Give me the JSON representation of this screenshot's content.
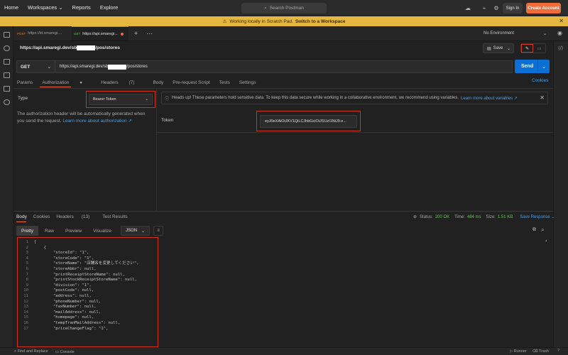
{
  "nav": {
    "home": "Home",
    "workspaces": "Workspaces",
    "reports": "Reports",
    "explore": "Explore",
    "search_placeholder": "Search Postman",
    "sign_in": "Sign In",
    "create_account": "Create Account"
  },
  "banner": {
    "text": "Working locally in Scratch Pad.",
    "link": "Switch to a Workspace"
  },
  "tabs": [
    {
      "method": "POST",
      "label": "https://id.smaregi...."
    },
    {
      "method": "GET",
      "label": "https://api.smaregi..."
    }
  ],
  "environment": "No Environment",
  "request": {
    "title_prefix": "https://api.smaregi.dev/sb",
    "title_suffix": "/pos/stores",
    "save_label": "Save",
    "method": "GET",
    "url_prefix": "https://api.smaregi.dev/sb",
    "url_suffix": "/pos/stores",
    "send_label": "Send",
    "tabs": {
      "params": "Params",
      "authorization": "Authorization",
      "headers": "Headers",
      "headers_count": "(7)",
      "body": "Body",
      "pre_request": "Pre-request Script",
      "tests": "Tests",
      "settings": "Settings"
    },
    "cookies": "Cookies"
  },
  "auth": {
    "type_label": "Type",
    "type_value": "Bearer Token",
    "help_text": "The authorization header will be automatically generated when you send the request.",
    "help_link": "Learn more about authorization ↗",
    "heads_up": "Heads up! These parameters hold sensitive data. To keep this data secure while working in a collaborative environment, we recommend using variables.",
    "heads_up_link": "Learn more about variables ↗",
    "token_label": "Token",
    "token_value": "eyJ0eXAiOiJKV1QiLCJhbGciOiJSUzI1NiJ9.e..."
  },
  "response": {
    "tabs": {
      "body": "Body",
      "cookies": "Cookies",
      "headers": "Headers",
      "headers_count": "(13)",
      "test_results": "Test Results"
    },
    "status_label": "Status:",
    "status_value": "200 OK",
    "time_label": "Time:",
    "time_value": "484 ms",
    "size_label": "Size:",
    "size_value": "1.51 KB",
    "save_response": "Save Response",
    "view_tabs": [
      "Pretty",
      "Raw",
      "Preview",
      "Visualize"
    ],
    "format": "JSON",
    "code_lines": [
      {
        "n": "1",
        "text": "["
      },
      {
        "n": "2",
        "text": "    {"
      },
      {
        "n": "3",
        "text": "        \"storeId\": \"1\","
      },
      {
        "n": "4",
        "text": "        \"storeCode\": \"1\","
      },
      {
        "n": "5",
        "text": "        \"storeName\": \"店舗名を変更してください\","
      },
      {
        "n": "6",
        "text": "        \"storeAbbr\": null,"
      },
      {
        "n": "7",
        "text": "        \"printReceiptStoreName\": null,"
      },
      {
        "n": "8",
        "text": "        \"printStockReceiptStoreName\": null,"
      },
      {
        "n": "9",
        "text": "        \"division\": \"1\","
      },
      {
        "n": "10",
        "text": "        \"postCode\": null,"
      },
      {
        "n": "11",
        "text": "        \"address\": null,"
      },
      {
        "n": "12",
        "text": "        \"phoneNumber\": null,"
      },
      {
        "n": "13",
        "text": "        \"faxNumber\": null,"
      },
      {
        "n": "14",
        "text": "        \"mailAddress\": null,"
      },
      {
        "n": "15",
        "text": "        \"homepage\": null,"
      },
      {
        "n": "16",
        "text": "        \"tempTranMailAddress\": null,"
      },
      {
        "n": "17",
        "text": "        \"priceChangeFlag\": \"1\","
      }
    ]
  },
  "bottom": {
    "find_replace": "Find and Replace",
    "console": "Console",
    "runner": "Runner",
    "trash": "Trash"
  },
  "colors": {
    "accent": "#f26b3a",
    "send": "#0b6fd6",
    "banner": "#e5b73f",
    "highlight_box": "#d4331a",
    "success": "#6bbf5c"
  }
}
